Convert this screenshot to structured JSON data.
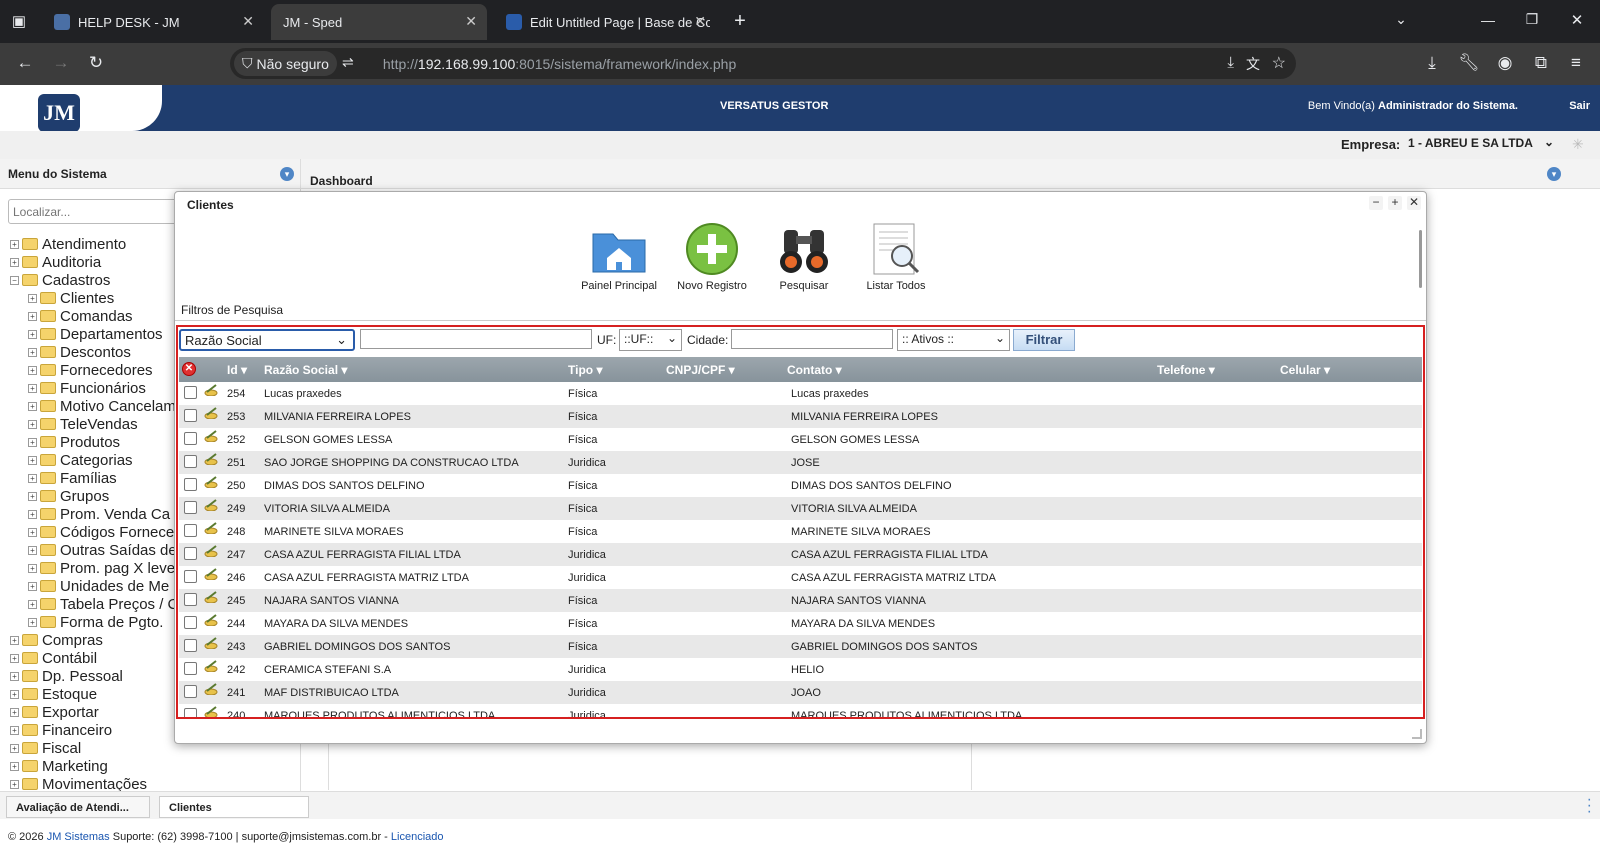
{
  "browser": {
    "tabs": [
      {
        "title": "HELP DESK - JM"
      },
      {
        "title": "JM - Sped"
      },
      {
        "title": "Edit Untitled Page | Base de Con"
      }
    ],
    "security_label": "Não seguro",
    "url_prefix": "http://",
    "url_host": "192.168.99.100",
    "url_rest": ":8015/sistema/framework/index.php"
  },
  "header": {
    "logo_text": "JM",
    "app_title": "VERSATUS GESTOR",
    "welcome_prefix": "Bem Vindo(a)",
    "welcome_user": "Administrador do Sistema.",
    "logout": "Sair"
  },
  "empresa": {
    "label": "Empresa:",
    "value": "1 - ABREU E SA LTDA"
  },
  "sidebar": {
    "title": "Menu do Sistema",
    "search_placeholder": "Localizar...",
    "items": [
      {
        "label": "Atendimento",
        "expander": "+",
        "child": false
      },
      {
        "label": "Auditoria",
        "expander": "+",
        "child": false
      },
      {
        "label": "Cadastros",
        "expander": "−",
        "child": false
      },
      {
        "label": "Clientes",
        "expander": "+",
        "child": true
      },
      {
        "label": "Comandas",
        "expander": "+",
        "child": true
      },
      {
        "label": "Departamentos",
        "expander": "+",
        "child": true
      },
      {
        "label": "Descontos",
        "expander": "+",
        "child": true
      },
      {
        "label": "Fornecedores",
        "expander": "+",
        "child": true
      },
      {
        "label": "Funcionários",
        "expander": "+",
        "child": true
      },
      {
        "label": "Motivo Cancelam",
        "expander": "+",
        "child": true
      },
      {
        "label": "TeleVendas",
        "expander": "+",
        "child": true
      },
      {
        "label": "Produtos",
        "expander": "+",
        "child": true
      },
      {
        "label": "Categorias",
        "expander": "+",
        "child": true
      },
      {
        "label": "Famílias",
        "expander": "+",
        "child": true
      },
      {
        "label": "Grupos",
        "expander": "+",
        "child": true
      },
      {
        "label": "Prom. Venda Ca",
        "expander": "+",
        "child": true
      },
      {
        "label": "Códigos Fornece",
        "expander": "+",
        "child": true
      },
      {
        "label": "Outras Saídas de",
        "expander": "+",
        "child": true
      },
      {
        "label": "Prom. pag X leve",
        "expander": "+",
        "child": true
      },
      {
        "label": "Unidades de Me",
        "expander": "+",
        "child": true
      },
      {
        "label": "Tabela Preços / C",
        "expander": "+",
        "child": true
      },
      {
        "label": "Forma de Pgto.",
        "expander": "+",
        "child": true
      },
      {
        "label": "Compras",
        "expander": "+",
        "child": false
      },
      {
        "label": "Contábil",
        "expander": "+",
        "child": false
      },
      {
        "label": "Dp. Pessoal",
        "expander": "+",
        "child": false
      },
      {
        "label": "Estoque",
        "expander": "+",
        "child": false
      },
      {
        "label": "Exportar",
        "expander": "+",
        "child": false
      },
      {
        "label": "Financeiro",
        "expander": "+",
        "child": false
      },
      {
        "label": "Fiscal",
        "expander": "+",
        "child": false
      },
      {
        "label": "Marketing",
        "expander": "+",
        "child": false
      },
      {
        "label": "Movimentações",
        "expander": "+",
        "child": false
      }
    ]
  },
  "dashboard": {
    "title": "Dashboard"
  },
  "modal": {
    "title": "Clientes",
    "toolbar": {
      "painel": "Painel Principal",
      "novo": "Novo Registro",
      "pesquisar": "Pesquisar",
      "listar": "Listar Todos"
    },
    "filters_label": "Filtros de Pesquisa",
    "filter": {
      "field_select": "Razão Social",
      "uf_label": "UF:",
      "uf_select": "::UF::",
      "cidade_label": "Cidade:",
      "status_select": ":: Ativos ::",
      "button": "Filtrar"
    },
    "columns": {
      "id": "Id",
      "razao": "Razão Social",
      "tipo": "Tipo",
      "cnpj": "CNPJ/CPF",
      "contato": "Contato",
      "telefone": "Telefone",
      "celular": "Celular"
    },
    "rows": [
      {
        "id": "254",
        "razao": "Lucas praxedes",
        "tipo": "Física",
        "contato": "Lucas praxedes"
      },
      {
        "id": "253",
        "razao": "MILVANIA FERREIRA LOPES",
        "tipo": "Física",
        "contato": "MILVANIA FERREIRA LOPES"
      },
      {
        "id": "252",
        "razao": "GELSON GOMES LESSA",
        "tipo": "Física",
        "contato": "GELSON GOMES LESSA"
      },
      {
        "id": "251",
        "razao": "SAO JORGE SHOPPING DA CONSTRUCAO LTDA",
        "tipo": "Juridica",
        "contato": "JOSE"
      },
      {
        "id": "250",
        "razao": "DIMAS DOS SANTOS DELFINO",
        "tipo": "Física",
        "contato": "DIMAS DOS SANTOS DELFINO"
      },
      {
        "id": "249",
        "razao": "VITORIA SILVA ALMEIDA",
        "tipo": "Física",
        "contato": "VITORIA SILVA ALMEIDA"
      },
      {
        "id": "248",
        "razao": "MARINETE SILVA MORAES",
        "tipo": "Física",
        "contato": "MARINETE SILVA MORAES"
      },
      {
        "id": "247",
        "razao": "CASA AZUL FERRAGISTA FILIAL LTDA",
        "tipo": "Juridica",
        "contato": "CASA AZUL FERRAGISTA FILIAL LTDA"
      },
      {
        "id": "246",
        "razao": "CASA AZUL FERRAGISTA MATRIZ LTDA",
        "tipo": "Juridica",
        "contato": "CASA AZUL FERRAGISTA MATRIZ LTDA"
      },
      {
        "id": "245",
        "razao": "NAJARA SANTOS VIANNA",
        "tipo": "Física",
        "contato": "NAJARA SANTOS VIANNA"
      },
      {
        "id": "244",
        "razao": "MAYARA DA SILVA MENDES",
        "tipo": "Física",
        "contato": "MAYARA DA SILVA MENDES"
      },
      {
        "id": "243",
        "razao": "GABRIEL DOMINGOS DOS SANTOS",
        "tipo": "Física",
        "contato": "GABRIEL DOMINGOS DOS SANTOS"
      },
      {
        "id": "242",
        "razao": "CERAMICA STEFANI S.A",
        "tipo": "Juridica",
        "contato": "HELIO"
      },
      {
        "id": "241",
        "razao": "MAF DISTRIBUICAO LTDA",
        "tipo": "Juridica",
        "contato": "JOAO"
      },
      {
        "id": "240",
        "razao": "MARQUES PRODUTOS ALIMENTICIOS LTDA",
        "tipo": "Juridica",
        "contato": "MARQUES PRODUTOS ALIMENTICIOS LTDA"
      }
    ]
  },
  "bottom_tabs": [
    "Avaliação de Atendi...",
    "Clientes"
  ],
  "footer": {
    "copy": "© 2026",
    "company": "JM Sistemas",
    "support": "Suporte: (62) 3998-7100 | suporte@jmsistemas.com.br -",
    "license": "Licenciado"
  }
}
